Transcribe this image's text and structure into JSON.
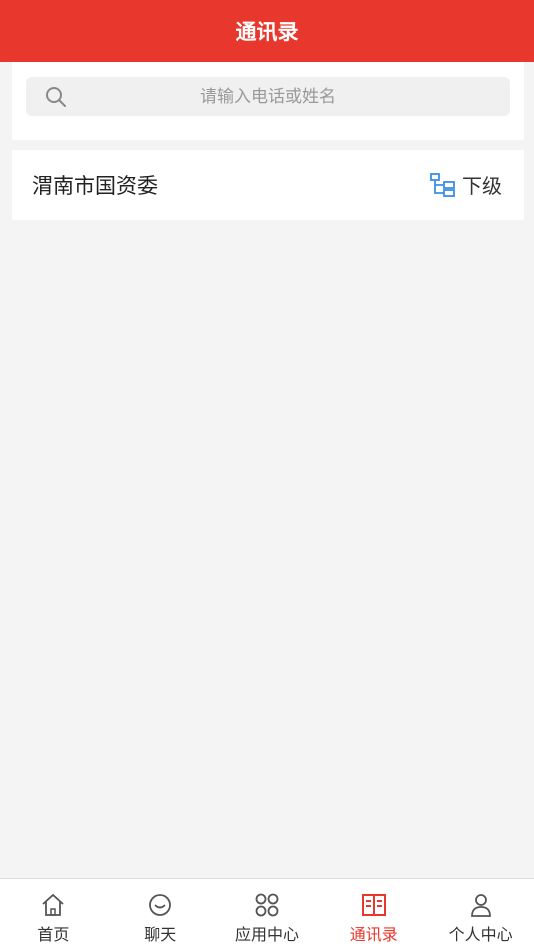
{
  "header": {
    "title": "通讯录"
  },
  "search": {
    "placeholder": "请输入电话或姓名"
  },
  "org": {
    "name": "渭南市国资委",
    "sub_label": "下级"
  },
  "tabs": [
    {
      "label": "首页",
      "icon": "home-icon"
    },
    {
      "label": "聊天",
      "icon": "chat-icon"
    },
    {
      "label": "应用中心",
      "icon": "apps-icon"
    },
    {
      "label": "通讯录",
      "icon": "contacts-book-icon",
      "active": true
    },
    {
      "label": "个人中心",
      "icon": "user-icon"
    }
  ],
  "colors": {
    "accent": "#e8372c",
    "link_icon": "#3a8ee6"
  }
}
